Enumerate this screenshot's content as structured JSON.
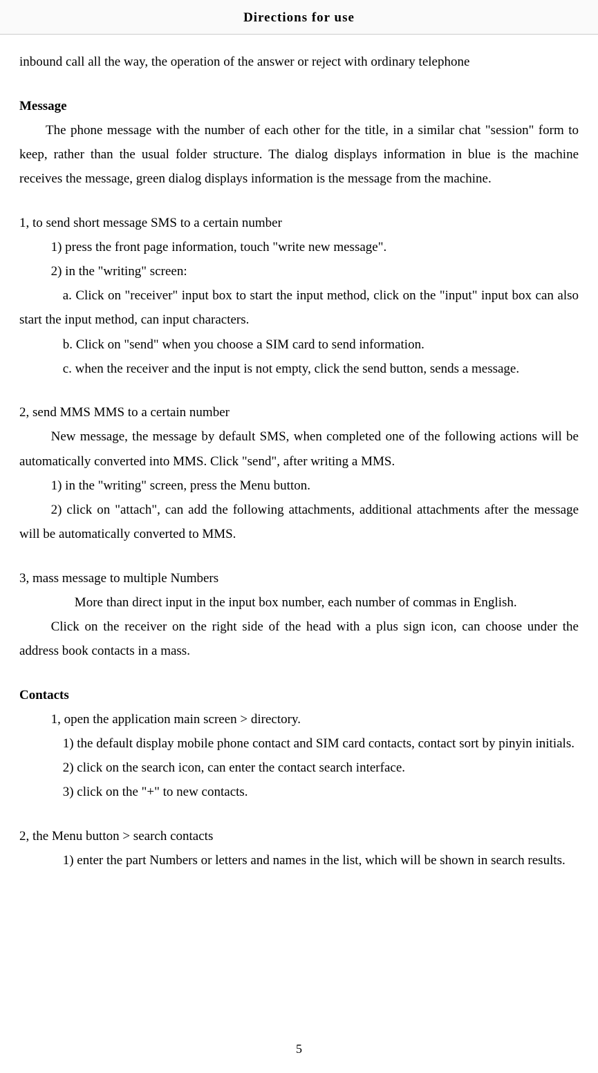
{
  "header": "Directions for use",
  "intro_cont": "inbound call all the way, the operation of the answer or reject with ordinary telephone",
  "message": {
    "heading": "Message",
    "body": "The phone message with the number of each other for the title, in a similar chat \"session\" form to keep, rather than the usual folder structure. The dialog displays information in blue is the machine receives the message, green dialog displays information is the message from the machine.",
    "s1": {
      "title": "1, to send short message SMS to a certain number",
      "l1": "1) press the front page information, touch \"write new message\".",
      "l2": "2) in the \"writing\" screen:",
      "a": "a. Click on \"receiver\" input box to start the input method, click on the \"input\" input box can also start the input method, can input characters.",
      "b": "b. Click on \"send\" when you choose a SIM card to send information.",
      "c": "c. when the receiver and the input is not empty, click the send button, sends a message."
    },
    "s2": {
      "title": "2, send MMS MMS to a certain number",
      "body": "New message, the message by default SMS, when completed one of the following actions will be automatically converted into MMS. Click \"send\", after writing a MMS.",
      "l1": "1) in the \"writing\" screen, press the Menu button.",
      "l2": "2) click on \"attach\", can add the following attachments, additional attachments after the message will be automatically converted to MMS."
    },
    "s3": {
      "title": "3, mass message to multiple Numbers",
      "body1": "More than direct input in the input box number, each number of commas in English.",
      "body2": "Click on the receiver on the right side of the head with a plus sign icon, can choose under the address book contacts in a mass."
    }
  },
  "contacts": {
    "heading": "Contacts",
    "s1": {
      "title": "1, open the application main screen > directory.",
      "l1": "1) the default display mobile phone contact and SIM card contacts, contact sort by pinyin initials.",
      "l2": "2) click on the search icon, can enter the contact search interface.",
      "l3": "3) click on the \"+\" to new contacts."
    },
    "s2": {
      "title": " 2, the Menu button > search contacts",
      "l1": "1) enter the part Numbers or letters and names in the list, which will be shown in search results."
    }
  },
  "page_number": "5"
}
